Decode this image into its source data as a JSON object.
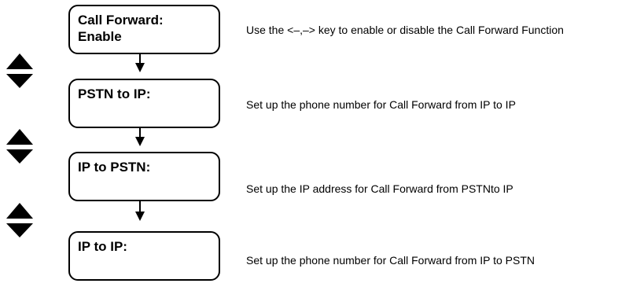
{
  "screens": [
    {
      "lines": [
        "Call Forward:",
        "Enable"
      ],
      "description": "Use the <–,–> key to enable or disable the Call Forward Function"
    },
    {
      "lines": [
        "PSTN to IP:",
        ""
      ],
      "description": "Set up the phone number for Call Forward from IP to IP"
    },
    {
      "lines": [
        "IP to PSTN:",
        ""
      ],
      "description": "Set up the IP address for Call Forward from PSTNto IP"
    },
    {
      "lines": [
        "IP to IP:",
        ""
      ],
      "description": "Set up the phone number for Call Forward from IP to PSTN"
    }
  ],
  "icons": {
    "nav": "up-down-triangle-icon",
    "flow": "down-arrow-icon"
  },
  "colors": {
    "ink": "#000000",
    "background": "#ffffff"
  }
}
